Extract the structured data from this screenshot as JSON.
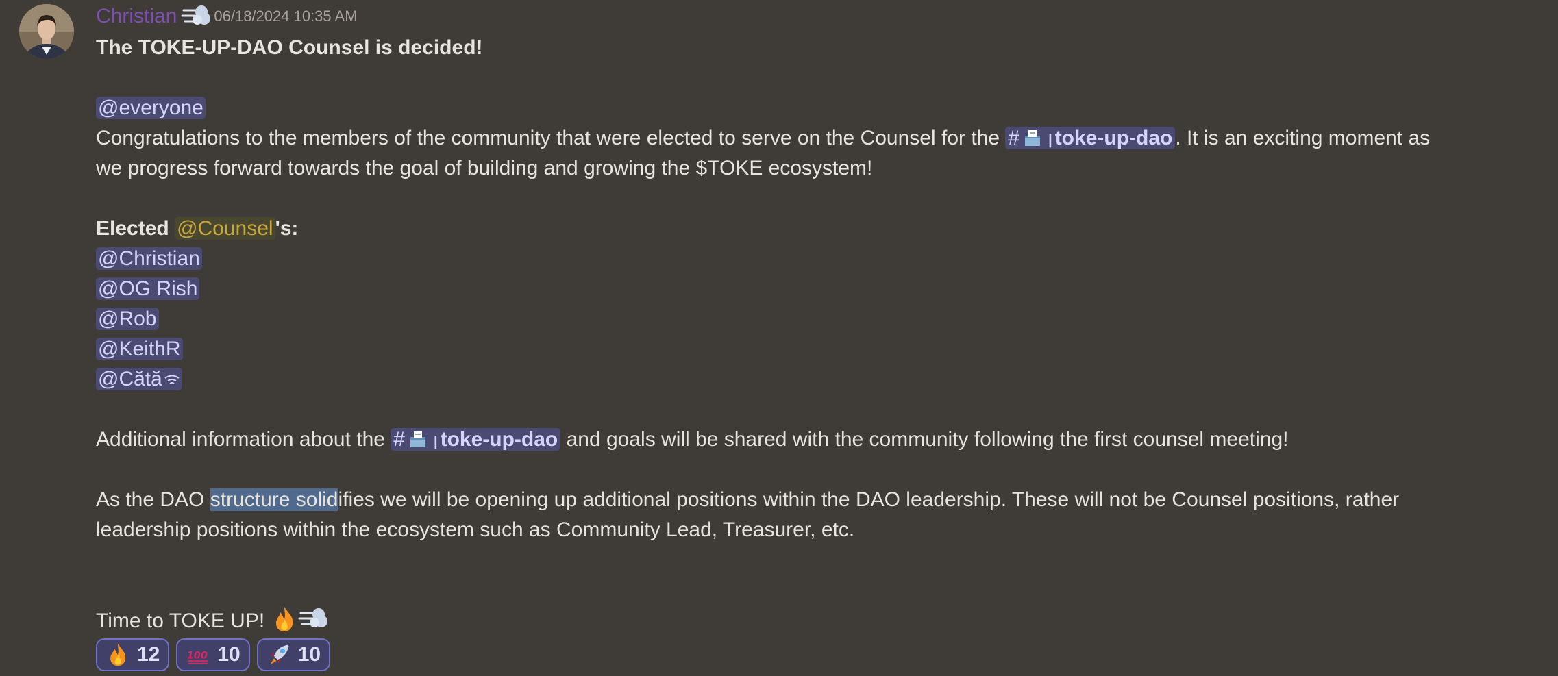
{
  "message": {
    "author": "Christian",
    "timestamp": "06/18/2024 10:35 AM",
    "title": "The TOKE-UP-DAO Counsel is decided!",
    "everyone_mention": "@everyone",
    "congrats_text_1": "Congratulations to the members of the community that were elected to serve on the Counsel for the",
    "channel_name": "toke-up-dao",
    "congrats_text_2": ".  It is an exciting moment as",
    "congrats_text_3": "we progress forward towards the goal of building and growing the $TOKE ecosystem!",
    "elected_prefix": "Elected",
    "role_mention": "@Counsel",
    "elected_suffix": "'s:",
    "members": [
      "@Christian",
      "@OG Rish",
      "@Rob",
      "@KeithR",
      "@Cătă"
    ],
    "additional_pre": "Additional information about the",
    "additional_post": "and goals will be shared with the community following the first counsel meeting!",
    "structure_pre": "As the DAO ",
    "structure_selected": "structure solid",
    "structure_post": "ifies we will be opening up additional positions within the DAO leadership. These will not be Counsel positions, rather",
    "structure_line2": "leadership positions within the ecosystem such as Community Lead, Treasurer, etc.",
    "closing": "Time to TOKE UP!"
  },
  "reactions": [
    {
      "emoji": "fire-emoji",
      "count": "12"
    },
    {
      "emoji": "hundred-emoji",
      "count": "10"
    },
    {
      "emoji": "rocket-emoji",
      "count": "10"
    }
  ],
  "colors": {
    "background": "#3f3c37",
    "username": "#7d4fb0",
    "mention_bg": "#4b4a72",
    "role_mention": "#c8a83e",
    "selection": "#4f6a8c"
  }
}
